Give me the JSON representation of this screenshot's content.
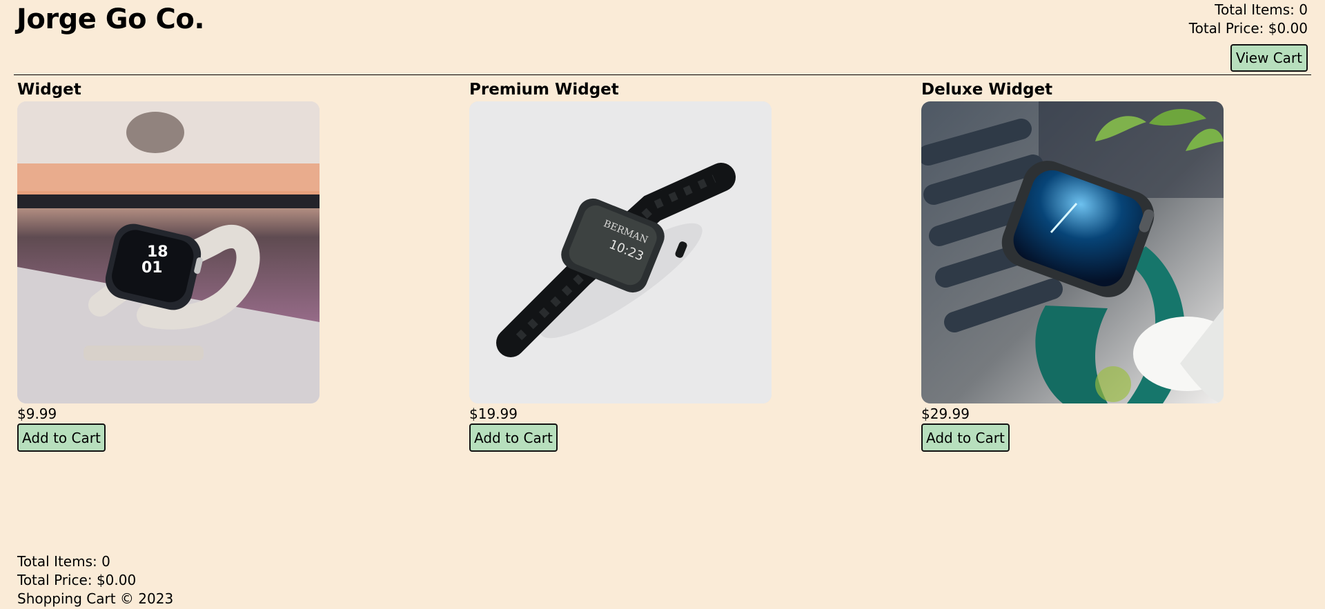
{
  "header": {
    "brand": "Jorge Go Co.",
    "total_items": "Total Items: 0",
    "total_price": "Total Price: $0.00",
    "view_cart_label": "View Cart"
  },
  "products": [
    {
      "name": "Widget",
      "image_alt": "white smartwatch on laptop",
      "price": "$9.99",
      "add_label": "Add to Cart"
    },
    {
      "name": "Premium Widget",
      "image_alt": "black smartwatch with link band",
      "price": "$19.99",
      "add_label": "Add to Cart"
    },
    {
      "name": "Deluxe Widget",
      "image_alt": "smartwatch with green leather band",
      "price": "$29.99",
      "add_label": "Add to Cart"
    }
  ],
  "footer": {
    "total_items": "Total Items: 0",
    "total_price": "Total Price: $0.00",
    "copyright": "Shopping Cart © 2023"
  },
  "colors": {
    "page_background": "#faebd7",
    "button_background": "#b7dfbd",
    "text": "#000000"
  }
}
